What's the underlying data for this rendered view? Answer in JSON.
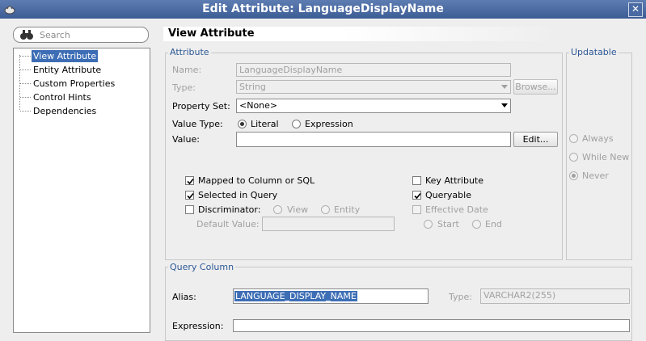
{
  "window": {
    "title": "Edit Attribute: LanguageDisplayName"
  },
  "search": {
    "placeholder": "Search"
  },
  "nav": {
    "items": [
      "View Attribute",
      "Entity Attribute",
      "Custom Properties",
      "Control Hints",
      "Dependencies"
    ],
    "selected": "View Attribute"
  },
  "panel": {
    "title": "View Attribute"
  },
  "attribute": {
    "legend": "Attribute",
    "name_label": "Name:",
    "name_value": "LanguageDisplayName",
    "type_label": "Type:",
    "type_value": "String",
    "browse_label": "Browse...",
    "property_set_label": "Property Set:",
    "property_set_value": "<None>",
    "value_type_label": "Value Type:",
    "value_type_literal": "Literal",
    "value_type_expression": "Expression",
    "value_type_selected": "Literal",
    "value_label": "Value:",
    "value_value": "",
    "edit_label": "Edit...",
    "mapped_label": "Mapped to Column or SQL",
    "mapped_checked": true,
    "selected_in_query_label": "Selected in Query",
    "selected_in_query_checked": true,
    "discriminator_label": "Discriminator:",
    "discriminator_checked": false,
    "disc_view": "View",
    "disc_entity": "Entity",
    "default_value_label": "Default Value:",
    "key_attribute_label": "Key Attribute",
    "key_attribute_checked": false,
    "queryable_label": "Queryable",
    "queryable_checked": true,
    "effective_date_label": "Effective Date",
    "effective_date_checked": false,
    "eff_start": "Start",
    "eff_end": "End"
  },
  "updatable": {
    "legend": "Updatable",
    "options": [
      "Always",
      "While New",
      "Never"
    ],
    "selected": "Never"
  },
  "query_column": {
    "legend": "Query Column",
    "alias_label": "Alias:",
    "alias_value": "LANGUAGE_DISPLAY_NAME",
    "type_label": "Type:",
    "type_value": "VARCHAR2(255)",
    "expression_label": "Expression:"
  },
  "colors": {
    "title_bar": "#4a6aa3",
    "selection": "#3d6eb5",
    "group_label": "#2d5896"
  },
  "icons": [
    "app-icon",
    "close-icon",
    "binoculars-search-icon"
  ]
}
